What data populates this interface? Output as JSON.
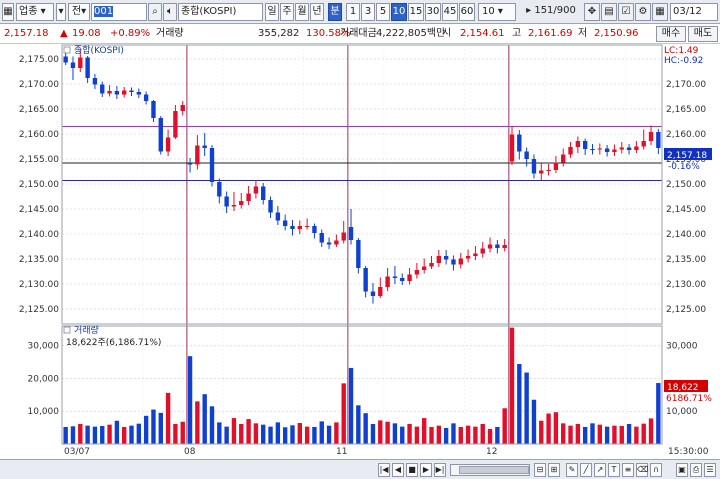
{
  "toolbar": {
    "category": "업종",
    "market": "전",
    "code": "001",
    "search_icon": "search-icon",
    "speaker_icon": "speaker-icon",
    "index_name": "종합(KOSPI)",
    "periods": [
      "일",
      "주",
      "월",
      "년",
      "분"
    ],
    "minutes": [
      "1",
      "3",
      "5",
      "10",
      "15",
      "30",
      "45",
      "60"
    ],
    "selected_period": "분",
    "selected_minute": "10",
    "count": "10",
    "range": "151/900",
    "date": "03/12"
  },
  "info": {
    "price": "2,157.18",
    "change": "19.08",
    "change_pct": "+0.89%",
    "volume_label": "거래량",
    "volume": "355,282",
    "volume_pct": "130.58%",
    "amount_label": "거래대금",
    "amount": "4,222,805백만",
    "open_label": "시",
    "open": "2,154.61",
    "high_label": "고",
    "high": "2,161.69",
    "low_label": "저",
    "low": "2,150.96",
    "buy_btn": "매수",
    "sell_btn": "매도"
  },
  "price_panel": {
    "title": "종합(KOSPI)",
    "lc": "LC:1.49",
    "hc": "HC:-0.92",
    "current_label": "2,157.18",
    "current_pct": "-0.16%",
    "yticks": [
      "2,175.00",
      "2,170.00",
      "2,165.00",
      "2,160.00",
      "2,155.00",
      "2,150.00",
      "2,145.00",
      "2,140.00",
      "2,135.00",
      "2,130.00",
      "2,125.00"
    ]
  },
  "volume_panel": {
    "title": "거래량",
    "legend": "18,622주(6,186.71%)",
    "current_label": "18,622",
    "current_pct": "6186.71%",
    "yticks": [
      "30,000",
      "20,000",
      "10,000"
    ]
  },
  "xaxis": {
    "labels": [
      "03/07",
      "08",
      "11",
      "12"
    ],
    "time_label": "15:30:00"
  },
  "chart_data": {
    "type": "candlestick",
    "ylim": [
      2122,
      2178
    ],
    "volume_ylim": [
      0,
      36000
    ],
    "h_lines": [
      2161.5,
      2154.2,
      2150.7
    ],
    "day_separators": [
      17,
      39,
      61
    ],
    "candles": [
      [
        2175.5,
        2174.3,
        2176.2,
        2173.8
      ],
      [
        2174.3,
        2173.2,
        2175.5,
        2170.8
      ],
      [
        2173.2,
        2175.3,
        2177.0,
        2172.4
      ],
      [
        2175.3,
        2171.2,
        2175.6,
        2170.2
      ],
      [
        2171.2,
        2169.9,
        2172.0,
        2169.0
      ],
      [
        2169.9,
        2168.1,
        2170.5,
        2167.4
      ],
      [
        2168.1,
        2168.6,
        2169.8,
        2167.5
      ],
      [
        2168.6,
        2167.9,
        2169.6,
        2167.0
      ],
      [
        2167.9,
        2168.7,
        2169.4,
        2167.3
      ],
      [
        2168.7,
        2168.4,
        2169.3,
        2167.6
      ],
      [
        2168.4,
        2167.9,
        2169.1,
        2167.2
      ],
      [
        2167.9,
        2166.6,
        2168.5,
        2165.9
      ],
      [
        2166.6,
        2163.2,
        2166.8,
        2162.4
      ],
      [
        2163.2,
        2156.5,
        2163.6,
        2155.9
      ],
      [
        2156.5,
        2159.3,
        2160.9,
        2155.6
      ],
      [
        2159.3,
        2164.6,
        2165.8,
        2159.0
      ],
      [
        2164.6,
        2165.8,
        2166.6,
        2163.7
      ],
      [
        2154.1,
        2153.9,
        2155.2,
        2152.3
      ],
      [
        2153.9,
        2157.7,
        2159.8,
        2152.9
      ],
      [
        2157.7,
        2157.2,
        2160.2,
        2155.6
      ],
      [
        2157.2,
        2150.4,
        2157.8,
        2149.5
      ],
      [
        2150.4,
        2147.5,
        2151.1,
        2146.1
      ],
      [
        2147.5,
        2145.5,
        2148.5,
        2144.2
      ],
      [
        2145.5,
        2145.8,
        2148.4,
        2144.6
      ],
      [
        2145.8,
        2146.6,
        2148.2,
        2145.1
      ],
      [
        2146.6,
        2148.1,
        2149.6,
        2145.8
      ],
      [
        2148.1,
        2149.5,
        2150.8,
        2147.1
      ],
      [
        2149.5,
        2146.8,
        2150.2,
        2145.9
      ],
      [
        2146.8,
        2144.3,
        2147.5,
        2143.2
      ],
      [
        2144.3,
        2142.7,
        2145.6,
        2141.8
      ],
      [
        2142.7,
        2141.6,
        2143.9,
        2140.7
      ],
      [
        2141.6,
        2141.0,
        2142.8,
        2139.7
      ],
      [
        2141.0,
        2141.6,
        2142.7,
        2140.0
      ],
      [
        2141.6,
        2141.6,
        2143.1,
        2140.9
      ],
      [
        2141.6,
        2140.2,
        2142.1,
        2139.1
      ],
      [
        2140.2,
        2138.3,
        2140.9,
        2137.4
      ],
      [
        2138.3,
        2137.9,
        2139.3,
        2137.0
      ],
      [
        2137.9,
        2138.7,
        2139.9,
        2137.4
      ],
      [
        2138.7,
        2140.3,
        2142.6,
        2138.1
      ],
      [
        2141.4,
        2138.8,
        2145.0,
        2137.9
      ],
      [
        2138.8,
        2133.2,
        2139.2,
        2132.1
      ],
      [
        2133.2,
        2128.5,
        2133.6,
        2127.3
      ],
      [
        2128.5,
        2127.6,
        2130.2,
        2126.1
      ],
      [
        2127.6,
        2129.4,
        2131.3,
        2127.2
      ],
      [
        2129.4,
        2131.5,
        2133.2,
        2128.6
      ],
      [
        2131.5,
        2131.2,
        2133.6,
        2130.0
      ],
      [
        2131.2,
        2130.6,
        2132.1,
        2129.8
      ],
      [
        2130.6,
        2131.9,
        2133.2,
        2129.9
      ],
      [
        2131.9,
        2132.8,
        2134.2,
        2131.1
      ],
      [
        2132.8,
        2133.5,
        2135.1,
        2132.1
      ],
      [
        2133.5,
        2134.2,
        2135.6,
        2133.0
      ],
      [
        2134.2,
        2135.6,
        2136.8,
        2133.4
      ],
      [
        2135.6,
        2134.9,
        2136.8,
        2133.9
      ],
      [
        2134.9,
        2133.9,
        2135.7,
        2132.7
      ],
      [
        2133.9,
        2135.1,
        2136.2,
        2133.1
      ],
      [
        2135.1,
        2135.6,
        2136.9,
        2134.3
      ],
      [
        2135.6,
        2136.1,
        2137.6,
        2134.8
      ],
      [
        2136.1,
        2137.1,
        2138.4,
        2135.3
      ],
      [
        2137.1,
        2137.9,
        2139.3,
        2136.3
      ],
      [
        2137.9,
        2137.2,
        2138.8,
        2136.1
      ],
      [
        2137.2,
        2137.8,
        2139.0,
        2136.5
      ],
      [
        2154.5,
        2159.9,
        2161.6,
        2153.8
      ],
      [
        2159.9,
        2156.5,
        2160.8,
        2154.9
      ],
      [
        2156.5,
        2155.0,
        2157.3,
        2153.5
      ],
      [
        2155.0,
        2152.1,
        2155.9,
        2151.1
      ],
      [
        2152.1,
        2152.7,
        2154.1,
        2150.8
      ],
      [
        2152.7,
        2152.8,
        2154.0,
        2151.7
      ],
      [
        2152.8,
        2154.3,
        2155.6,
        2152.2
      ],
      [
        2154.3,
        2155.9,
        2157.1,
        2153.5
      ],
      [
        2155.9,
        2157.4,
        2158.4,
        2155.2
      ],
      [
        2157.4,
        2158.6,
        2159.5,
        2156.2
      ],
      [
        2158.6,
        2157.0,
        2159.1,
        2155.8
      ],
      [
        2157.0,
        2156.9,
        2158.0,
        2155.9
      ],
      [
        2156.9,
        2157.1,
        2158.1,
        2155.9
      ],
      [
        2157.1,
        2156.4,
        2157.8,
        2155.5
      ],
      [
        2156.4,
        2156.9,
        2157.9,
        2155.6
      ],
      [
        2156.9,
        2157.3,
        2158.4,
        2156.1
      ],
      [
        2157.3,
        2156.8,
        2158.0,
        2155.9
      ],
      [
        2156.8,
        2157.5,
        2158.6,
        2156.2
      ],
      [
        2157.5,
        2158.6,
        2160.9,
        2156.9
      ],
      [
        2158.6,
        2160.4,
        2161.7,
        2157.8
      ],
      [
        2160.4,
        2157.2,
        2161.0,
        2156.0
      ]
    ],
    "volumes": [
      5200,
      5400,
      6100,
      5600,
      5300,
      5500,
      5900,
      7100,
      5200,
      5600,
      6200,
      8600,
      10500,
      9500,
      15600,
      6100,
      6800,
      26800,
      13000,
      15200,
      11500,
      6600,
      5300,
      7900,
      6100,
      7600,
      6300,
      5900,
      5300,
      6600,
      5100,
      5700,
      6400,
      5300,
      5200,
      6900,
      5600,
      6600,
      18500,
      23200,
      11800,
      9400,
      6100,
      7200,
      6800,
      6300,
      5300,
      6100,
      5300,
      7900,
      5200,
      5600,
      4900,
      6300,
      5200,
      5600,
      5300,
      6100,
      4600,
      5200,
      10900,
      35500,
      24400,
      21800,
      13500,
      7100,
      9300,
      9700,
      6300,
      5600,
      6100,
      5200,
      6300,
      5900,
      5300,
      5600,
      5500,
      6100,
      5300,
      6200,
      7800,
      18600
    ]
  }
}
